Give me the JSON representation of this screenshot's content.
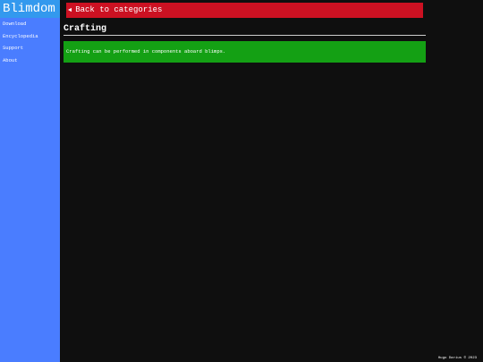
{
  "sidebar": {
    "logo": "Blimdom",
    "items": [
      {
        "label": "Download"
      },
      {
        "label": "Encyclopedia"
      },
      {
        "label": "Support"
      },
      {
        "label": "About"
      }
    ]
  },
  "main": {
    "back_button": {
      "icon": "left-triangle-arrow",
      "label": "Back to categories"
    },
    "title": "Crafting",
    "content": "Crafting can be performed in components aboard blimps."
  },
  "footer": {
    "text": "Hugo Darius © 2023"
  },
  "colors": {
    "page_background": "#0f0f0f",
    "sidebar_background": "#4a7dff",
    "logo_background": "#3399ee",
    "back_button_background": "#cc1122",
    "content_background": "#14a014",
    "text": "#ffffff"
  }
}
